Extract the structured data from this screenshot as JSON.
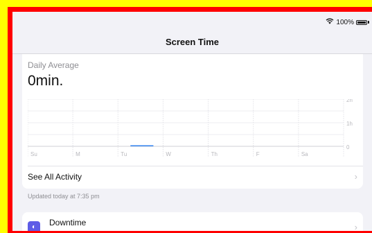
{
  "status": {
    "battery_percent": "100%",
    "battery_level": 1.0,
    "wifi_icon": "wifi-icon"
  },
  "nav": {
    "title": "Screen Time"
  },
  "summary": {
    "label": "Daily Average",
    "value": "0min."
  },
  "chart_data": {
    "type": "bar",
    "categories": [
      "Su",
      "M",
      "Tu",
      "W",
      "Th",
      "F",
      "Sa"
    ],
    "values": [
      0,
      0,
      0.01,
      0,
      0,
      0,
      0
    ],
    "y_ticks": [
      "2h",
      "1h",
      "0"
    ],
    "ylim": [
      0,
      2
    ],
    "grid": true,
    "accent": "#2f80ed"
  },
  "actions": {
    "see_all": "See All Activity",
    "updated": "Updated today at 7:35 pm"
  },
  "downtime": {
    "label": "Downtime",
    "icon": "downtime-icon",
    "color": "#5e5ce6"
  }
}
